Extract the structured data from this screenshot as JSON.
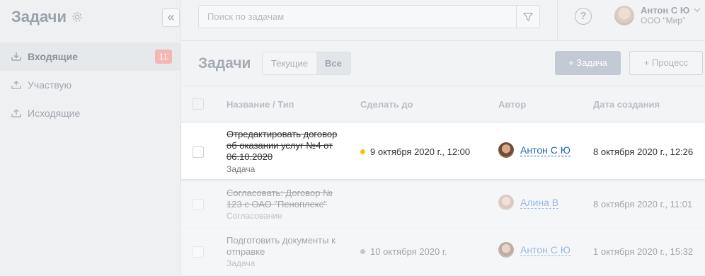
{
  "sidebar": {
    "title": "Задачи",
    "collapse_glyph": "«",
    "items": [
      {
        "label": "Входящие",
        "icon": "inbox-icon",
        "badge": "11",
        "active": true
      },
      {
        "label": "Участвую",
        "icon": "participate-icon",
        "active": false
      },
      {
        "label": "Исходящие",
        "icon": "outbox-icon",
        "active": false
      }
    ]
  },
  "topbar": {
    "search_placeholder": "Поиск по задачам",
    "help_glyph": "?",
    "user": {
      "name": "Антон С Ю",
      "org": "ООО \"Мир\""
    }
  },
  "main": {
    "title": "Задачи",
    "filters": [
      {
        "label": "Текущие",
        "selected": false
      },
      {
        "label": "Все",
        "selected": true
      }
    ],
    "new_task_label": "+ Задача",
    "new_process_label": "+ Процесс"
  },
  "table": {
    "columns": [
      "Название / Тип",
      "Сделать до",
      "Автор",
      "Дата создания"
    ],
    "rows": [
      {
        "name": "Отредактировать договор об оказании услуг №4 от 06.10.2020",
        "type": "Задача",
        "due": "9 октября 2020 г., 12:00",
        "due_dot_color": "#f2c600",
        "author": "Антон С Ю",
        "created": "8 октября 2020 г., 12:26",
        "completed": true,
        "highlighted": true
      },
      {
        "name": "Согласовать: Договор № 123 с ОАО \"Пеноплекс\"",
        "type": "Согласование",
        "due": "",
        "author": "Алина В",
        "created": "8 октября 2020 г., 11:01",
        "completed": true,
        "highlighted": false
      },
      {
        "name": "Подготовить документы к отправке",
        "type": "Задача",
        "due": "10 октября 2020 г.",
        "due_dot_color": "#888888",
        "author": "Антон С Ю",
        "created": "1 октября 2020 г., 15:32",
        "completed": false,
        "highlighted": false
      }
    ]
  },
  "colors": {
    "accent_link": "#2067b0",
    "badge": "#f2b7b3",
    "primary_button": "#c3cad3"
  }
}
